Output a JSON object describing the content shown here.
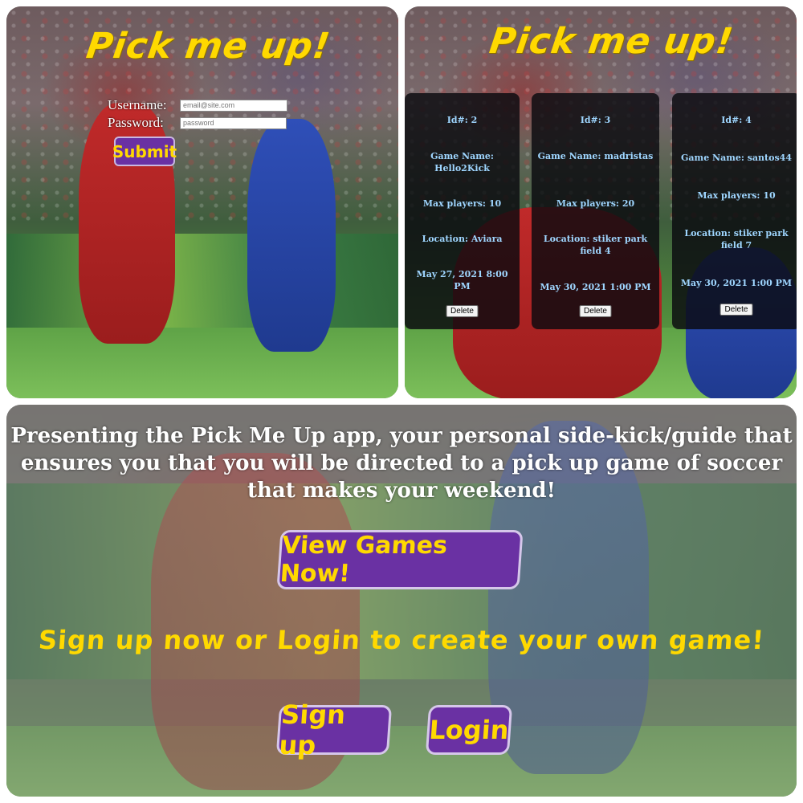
{
  "login_panel": {
    "title": "Pick me up!",
    "username_label": "Username:",
    "username_placeholder": "email@site.com",
    "password_label": "Password:",
    "password_placeholder": "password",
    "submit_label": "Submit"
  },
  "games_panel": {
    "title": "Pick me up!",
    "games": [
      {
        "id": "Id#: 2",
        "name": "Game Name: Hello2Kick",
        "max_players": "Max players: 10",
        "location": "Location: Aviara",
        "date": "May 27, 2021 8:00 PM",
        "delete_label": "Delete"
      },
      {
        "id": "Id#: 3",
        "name": "Game Name: madristas",
        "max_players": "Max players: 20",
        "location": "Location: stiker park field 4",
        "date": "May 30, 2021 1:00 PM",
        "delete_label": "Delete"
      },
      {
        "id": "Id#: 4",
        "name": "Game Name: santos44",
        "max_players": "Max players: 10",
        "location": "Location: stiker park field 7",
        "date": "May 30, 2021 1:00 PM",
        "delete_label": "Delete"
      }
    ]
  },
  "landing": {
    "intro": "Presenting the Pick Me Up app, your personal side-kick/guide that ensures you that you will be directed to a pick up game of soccer that makes your weekend!",
    "view_games_label": "View Games Now!",
    "cta": "Sign up now or Login to create your own game!",
    "signup_label": "Sign up",
    "login_label": "Login"
  },
  "colors": {
    "accent_yellow": "#ffd900",
    "button_purple": "#6a31a3",
    "card_text": "#9fd6ff"
  }
}
